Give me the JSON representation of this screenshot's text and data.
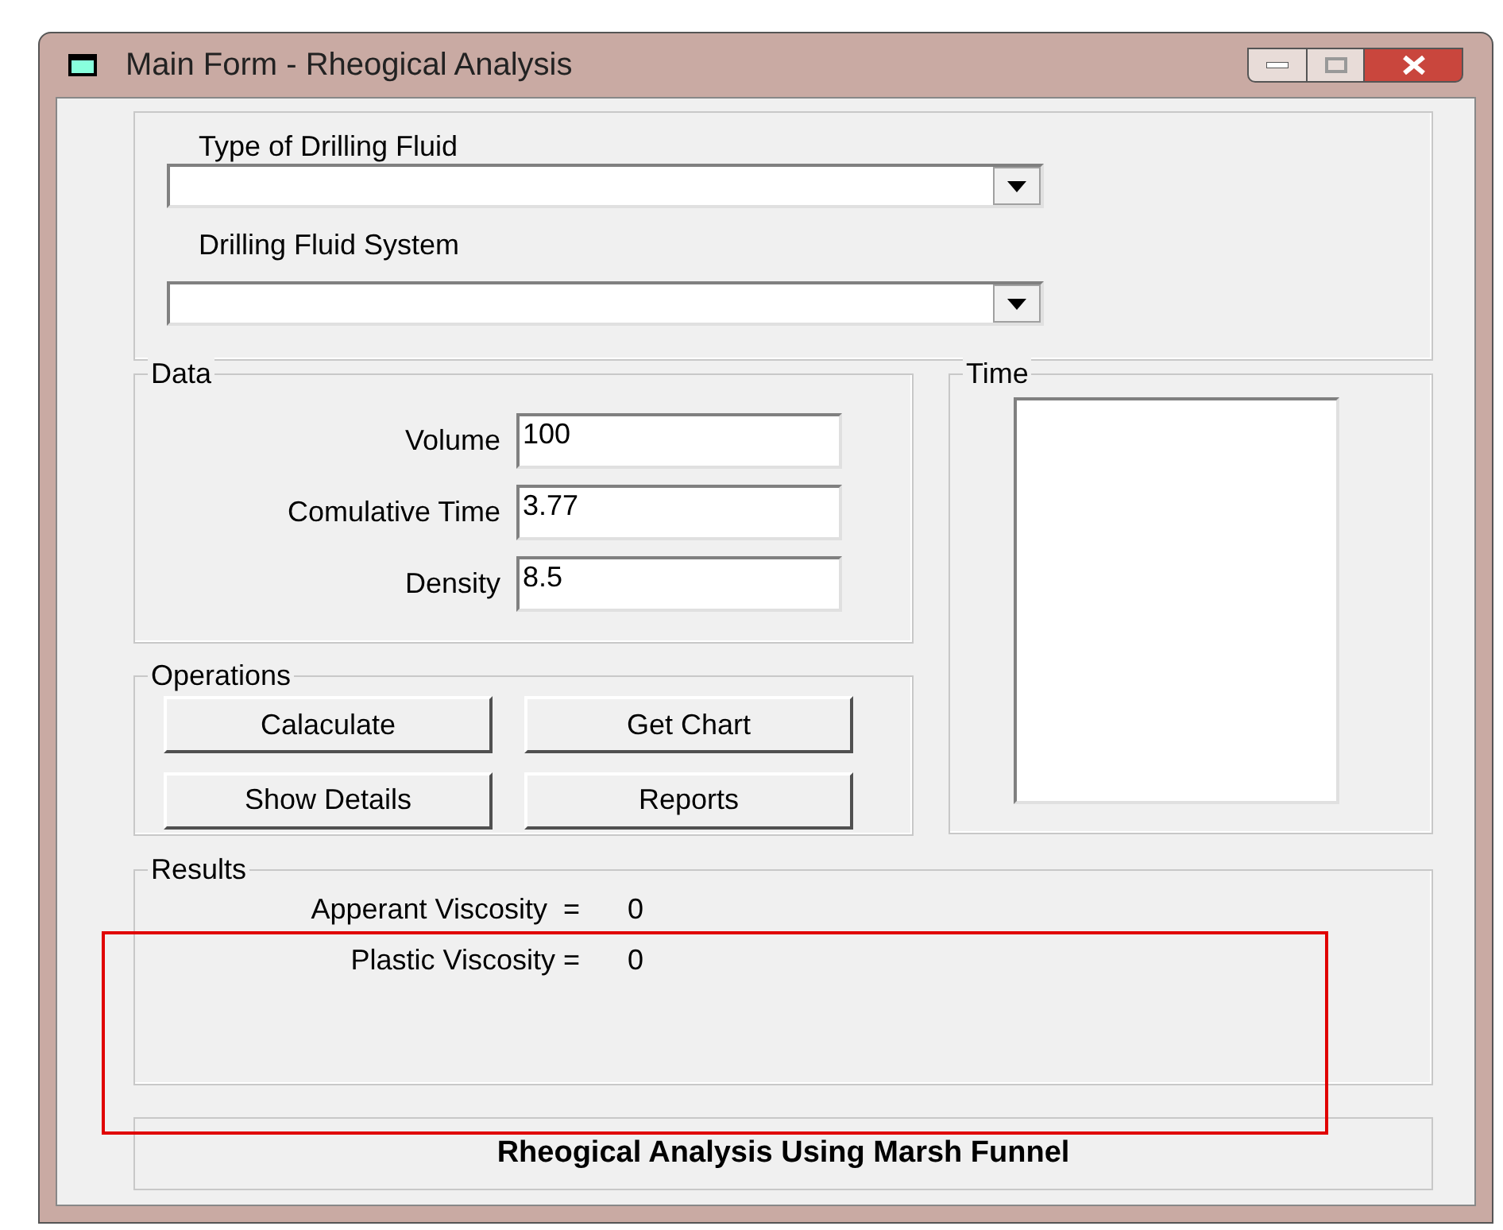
{
  "window": {
    "title": "Main Form - Rheogical Analysis"
  },
  "fluid": {
    "type_label": "Type of Drilling Fluid",
    "system_label": "Drilling Fluid System"
  },
  "data": {
    "caption": "Data",
    "fields": [
      {
        "label": "Volume",
        "value": "100"
      },
      {
        "label": "Comulative Time",
        "value": "3.77"
      },
      {
        "label": "Density",
        "value": "8.5"
      }
    ]
  },
  "time": {
    "caption": "Time"
  },
  "operations": {
    "caption": "Operations",
    "buttons": [
      "Calaculate",
      "Get Chart",
      "Show Details",
      "Reports"
    ]
  },
  "results": {
    "caption": "Results",
    "rows": [
      {
        "label": "Apperant Viscosity  =",
        "value": "0"
      },
      {
        "label": "Plastic Viscosity =",
        "value": "0"
      }
    ]
  },
  "footer": "Rheogical Analysis Using Marsh Funnel"
}
